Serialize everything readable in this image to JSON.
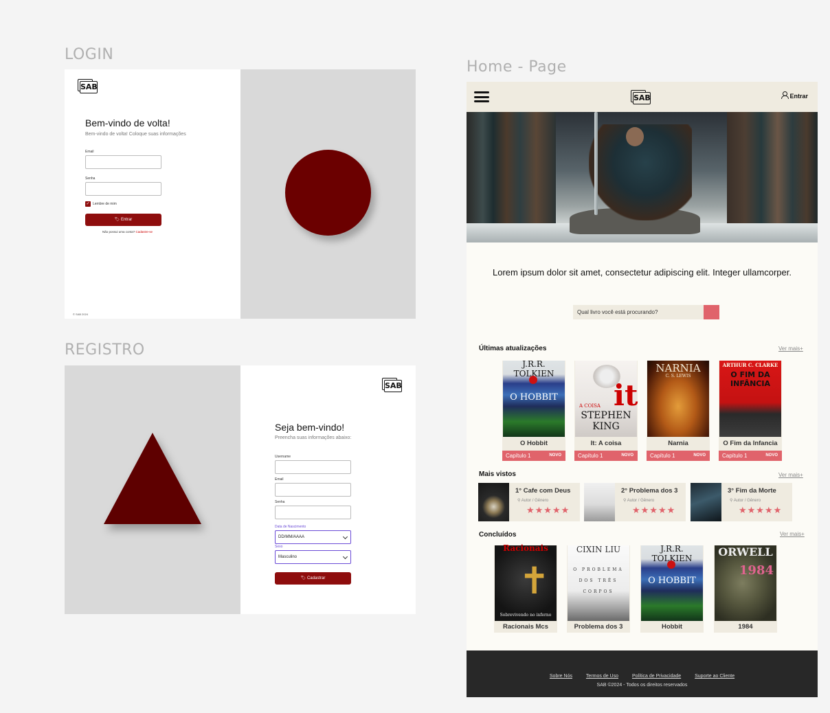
{
  "frames": {
    "login": "LOGIN",
    "registro": "REGISTRO",
    "home": "Home - Page"
  },
  "logo": "SAB",
  "login": {
    "title": "Bem-vindo de volta!",
    "subtitle": "Bem-vindo de volta! Coloque suas informações",
    "email_label": "Email",
    "senha_label": "Senha",
    "remember": "Lembre de mim",
    "button": "Entrar",
    "no_account": "Não possui uma conta?",
    "register_link": "Cadastre-se",
    "copyright": "© SAB 2024",
    "accent": "#8e0d0d"
  },
  "registro": {
    "title": "Seja bem-vindo!",
    "subtitle": "Preencha suas informações abaixo:",
    "username_label": "Username",
    "email_label": "Email",
    "senha_label": "Senha",
    "birth_label": "Data de Nascimento",
    "birth_value": "DD/MM/AAAA",
    "sexo_label": "Sexo",
    "sexo_value": "Masculino",
    "button": "Cadastrar"
  },
  "home": {
    "login_label": "Entrar",
    "tagline": "Lorem ipsum dolor sit amet, consectetur adipiscing elit. Integer ullamcorper.",
    "search_placeholder": "Qual livro você está procurando?",
    "latest_title": "Últimas atualizações",
    "most_viewed_title": "Mais vistos",
    "finished_title": "Concluídos",
    "see_more": "Ver mais+",
    "latest": [
      {
        "name": "O Hobbit",
        "chapter": "Capítulo 1",
        "badge": "NOVO",
        "cover_top": "J.R.R. TOLKIEN",
        "cover_mid": "O HOBBIT"
      },
      {
        "name": "It: A coisa",
        "chapter": "Capítulo 1",
        "badge": "NOVO",
        "cover_top": "A COISA",
        "cover_mid": "STEPHEN KING"
      },
      {
        "name": "Narnia",
        "chapter": "Capítulo 1",
        "badge": "NOVO",
        "cover_top": "NARNIA",
        "cover_mid": "C. S. LEWIS"
      },
      {
        "name": "O Fim da Infancia",
        "chapter": "Capítulo 1",
        "badge": "NOVO",
        "cover_top": "ARTHUR C. CLARKE",
        "cover_mid": "O FIM DA INFÂNCIA"
      }
    ],
    "most_viewed": [
      {
        "rank": "1° Cafe com Deus",
        "meta": "Autor / Gênero",
        "stars": "★★★★★"
      },
      {
        "rank": "2° Problema dos 3",
        "meta": "Autor / Gênero",
        "stars": "★★★★★"
      },
      {
        "rank": "3° Fim da Morte",
        "meta": "Autor / Gênero",
        "stars": "★★★★★"
      }
    ],
    "finished": [
      {
        "name": "Racionais Mcs",
        "cover_top": "Racionais",
        "cover_bottom": "Sobrevivendo no inferno"
      },
      {
        "name": "Problema dos 3",
        "cover_top": "CIXIN LIU",
        "cover_bottom": "O PROBLEMA DOS TRÊS CORPOS"
      },
      {
        "name": "Hobbit",
        "cover_top": "J.R.R. TOLKIEN",
        "cover_bottom": "O HOBBIT"
      },
      {
        "name": "1984",
        "cover_top": "ORWELL",
        "cover_bottom": "1984"
      }
    ],
    "footer_links": [
      "Sobre Nós",
      "Termos de Uso",
      "Política de Privacidade",
      "Suporte ao Cliente"
    ],
    "footer_copy": "SAB ©2024 - Todos os direitos reservados",
    "accent": "#e0636b",
    "cream": "#efebe0"
  }
}
